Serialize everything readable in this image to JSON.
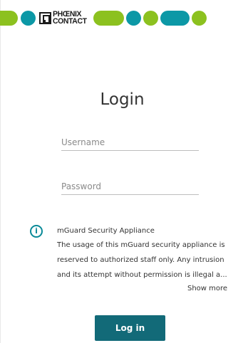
{
  "brand": {
    "logo_line1": "PHŒNIX",
    "logo_line2": "CONTACT",
    "colors": {
      "green": "#8cc11f",
      "teal": "#0c98a6"
    }
  },
  "login": {
    "title": "Login",
    "username_placeholder": "Username",
    "password_placeholder": "Password",
    "submit_label": "Log in",
    "button_color": "#126a78"
  },
  "notice": {
    "icon": "info-icon",
    "title": "mGuard Security Appliance",
    "lines": [
      "The usage of this mGuard security appliance is",
      "reserved to authorized staff only. Any intrusion",
      "and its attempt without permission is illegal a..."
    ],
    "show_more_label": "Show more"
  }
}
